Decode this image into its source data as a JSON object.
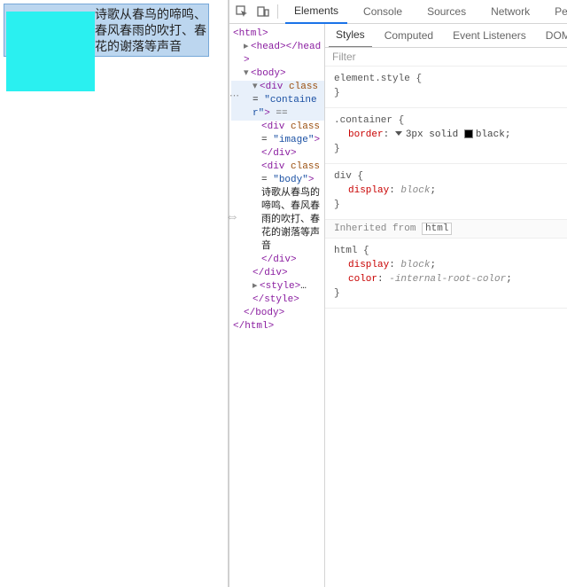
{
  "rendered": {
    "body_text": "诗歌从春鸟的啼鸣、春风春雨的吹打、春花的谢落等声音"
  },
  "toolbar": {
    "tabs": [
      "Elements",
      "Console",
      "Sources",
      "Network",
      "Perfor"
    ]
  },
  "dom": {
    "html_open": "<html>",
    "head": "<head>",
    "head_close": "</head>",
    "body_open": "<body>",
    "container_open_a": "<div",
    "container_open_b": "class",
    "container_open_c": "\"container\"",
    "container_open_d": ">",
    "image_open_a": "<div",
    "image_open_b": "class",
    "image_open_c": "\"image\"",
    "image_open_d": ">",
    "div_close": "</div>",
    "bodydiv_open_a": "<div",
    "bodydiv_open_b": "class",
    "bodydiv_open_c": "\"body\"",
    "bodydiv_open_d": ">",
    "body_text": "诗歌从春鸟的啼鸣、春风春雨的吹打、春花的谢落等声音",
    "style_open": "<style>",
    "style_ellipsis": "…",
    "style_close": "</style>",
    "body_close": "</body>",
    "html_close": "</html>",
    "eq_token": " == "
  },
  "styles_tabs": [
    "Styles",
    "Computed",
    "Event Listeners",
    "DOM"
  ],
  "filter_placeholder": "Filter",
  "rules": {
    "r1_sel": "element.style",
    "r2_sel": ".container",
    "r2_p1_name": "border",
    "r2_p1_val": "3px solid ",
    "r2_p1_color": "black",
    "r3_sel": "div",
    "r3_p1_name": "display",
    "r3_p1_val": "block",
    "inherited_label": "Inherited from",
    "inherited_from": "html",
    "r4_sel": "html",
    "r4_p1_name": "display",
    "r4_p1_val": "block",
    "r4_p2_name": "color",
    "r4_p2_val": "-internal-root-color"
  }
}
